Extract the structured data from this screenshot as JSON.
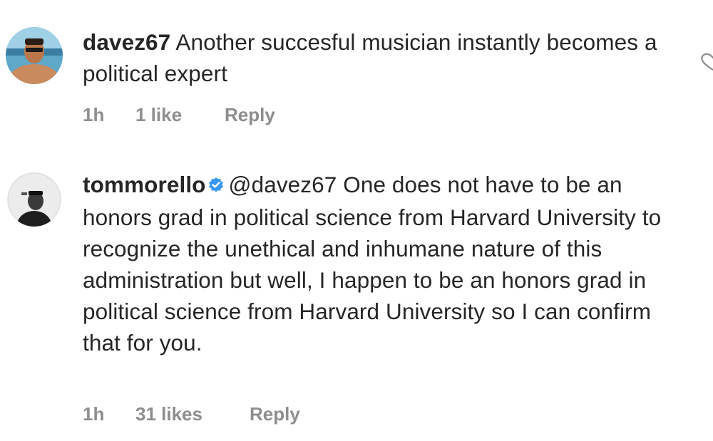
{
  "comments": [
    {
      "username": "davez67",
      "mention": "",
      "text": " Another succesful musician instantly becomes a political expert",
      "time": "1h",
      "likes": "1 like",
      "reply": "Reply",
      "verified": false
    },
    {
      "username": "tommorello",
      "mention": "@davez67",
      "text": " One does not have to be an honors grad in political science from Harvard University to recognize the unethical and inhumane nature of this administration but well, I happen to be an honors grad in political science from Harvard University so I can confirm that for you.",
      "time": "1h",
      "likes": "31 likes",
      "reply": "Reply",
      "verified": true
    }
  ],
  "colors": {
    "text": "#262626",
    "muted": "#8e8e8e",
    "verified": "#3897f0"
  },
  "icons": {
    "like": "heart-icon",
    "verified": "verified-badge-icon"
  }
}
